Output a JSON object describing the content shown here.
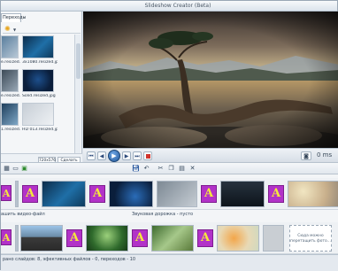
{
  "window": {
    "title": "Slideshow Creator (Beta)"
  },
  "left_panel": {
    "tab_transitions": "Переходы",
    "files": [
      {
        "label": "e.resized.jpg"
      },
      {
        "label": "3x1080.resized.jpg"
      },
      {
        "label": "e.resized.jpg"
      },
      {
        "label": "Solid.resized.jpg"
      },
      {
        "label": "1.resized.jpg"
      },
      {
        "label": "HD 013.resized.jpg"
      }
    ],
    "footer_left": "720x576 4:3",
    "footer_right": "Сделать видео-файл"
  },
  "preview": {
    "time": "0 ms"
  },
  "timeline": {
    "audio_label_left": "ашить видео-файл",
    "audio_label_right": "Звуковая дорожка - пусто",
    "drop_hint": "Сюда можно перетащить фото..."
  },
  "statusbar": {
    "text": "рано слайдов: 8, эфективных файлов - 0, переходов - 10"
  },
  "icons": {
    "sun": "sun-icon",
    "play": "play-icon",
    "stop": "stop-icon",
    "camera": "camera-icon"
  }
}
